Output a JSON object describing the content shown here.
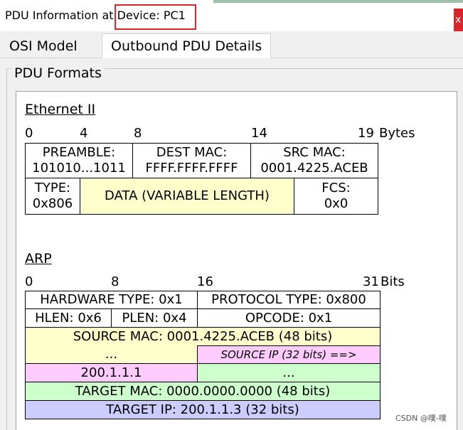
{
  "window": {
    "title_prefix": "PDU Information at ",
    "title_device": "Device: PC1",
    "close_label": "x"
  },
  "tabs": {
    "osi": "OSI Model",
    "outbound": "Outbound PDU Details"
  },
  "pdu_formats": {
    "legend": "PDU Formats",
    "ethernet": {
      "title": "Ethernet II",
      "ticks": [
        "0",
        "4",
        "8",
        "14",
        "19"
      ],
      "unit": "Bytes",
      "preamble_label": "PREAMBLE:",
      "preamble_value": "101010...1011",
      "dest_label": "DEST MAC:",
      "dest_value": "FFFF.FFFF.FFFF",
      "src_label": "SRC MAC:",
      "src_value": "0001.4225.ACEB",
      "type_label": "TYPE:",
      "type_value": "0x806",
      "data_label": "DATA (VARIABLE LENGTH)",
      "fcs_label": "FCS:",
      "fcs_value": "0x0"
    },
    "arp": {
      "title": "ARP",
      "ticks": [
        "0",
        "8",
        "16",
        "31"
      ],
      "unit": "Bits",
      "hardware_type": "HARDWARE TYPE: 0x1",
      "protocol_type": "PROTOCOL TYPE: 0x800",
      "hlen": "HLEN: 0x6",
      "plen": "PLEN: 0x4",
      "opcode": "OPCODE: 0x1",
      "source_mac": "SOURCE MAC: 0001.4225.ACEB (48 bits)",
      "ellipsis_left": "...",
      "source_ip_label": "SOURCE IP (32 bits) ==>",
      "source_ip_value": "200.1.1.1",
      "ellipsis_right": "...",
      "target_mac": "TARGET MAC: 0000.0000.0000 (48 bits)",
      "target_ip": "TARGET IP: 200.1.1.3 (32 bits)"
    }
  },
  "watermark": "CSDN @噗-噗",
  "colors": {
    "highlight_border": "#d9262b",
    "yellow": "#ffffcc",
    "pink": "#ffccff",
    "green": "#ccffcc",
    "blue": "#ccccff"
  }
}
